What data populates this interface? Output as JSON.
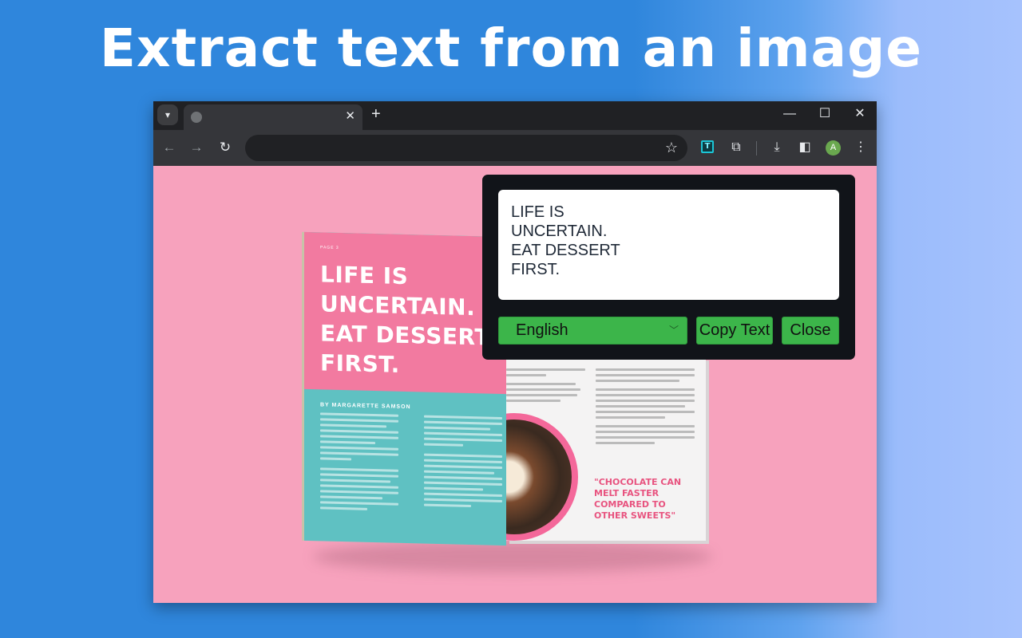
{
  "headline": "Extract text from an image",
  "browser": {
    "tab": {
      "title": "",
      "close_icon": "close-icon"
    },
    "tab_search_icon": "chevron-down-icon",
    "new_tab_icon": "plus-icon",
    "window_controls": [
      "minimize",
      "maximize",
      "close"
    ],
    "toolbar": {
      "back_icon": "arrow-left-icon",
      "forward_icon": "arrow-right-icon",
      "reload_icon": "reload-icon",
      "omnibox_value": "",
      "bookmark_icon": "star-icon",
      "extension_icon_label": "T",
      "avatar_initial": "A"
    }
  },
  "magazine": {
    "page_label": "PAGE 3",
    "headline": "LIFE IS UNCERTAIN. EAT DESSERT FIRST.",
    "author": "BY MARGARETTE SAMSON",
    "quote": "\"CHOCOLATE CAN MELT FASTER COMPARED TO OTHER SWEETS\""
  },
  "popup": {
    "extracted_text": "LIFE IS\nUNCERTAIN.\nEAT DESSERT\nFIRST.",
    "language": "English",
    "copy_label": "Copy Text",
    "close_label": "Close"
  },
  "colors": {
    "background_blue": "#2f86dc",
    "page_pink": "#f7a2bd",
    "popup_bg": "#111419",
    "button_green": "#3cb54a"
  }
}
